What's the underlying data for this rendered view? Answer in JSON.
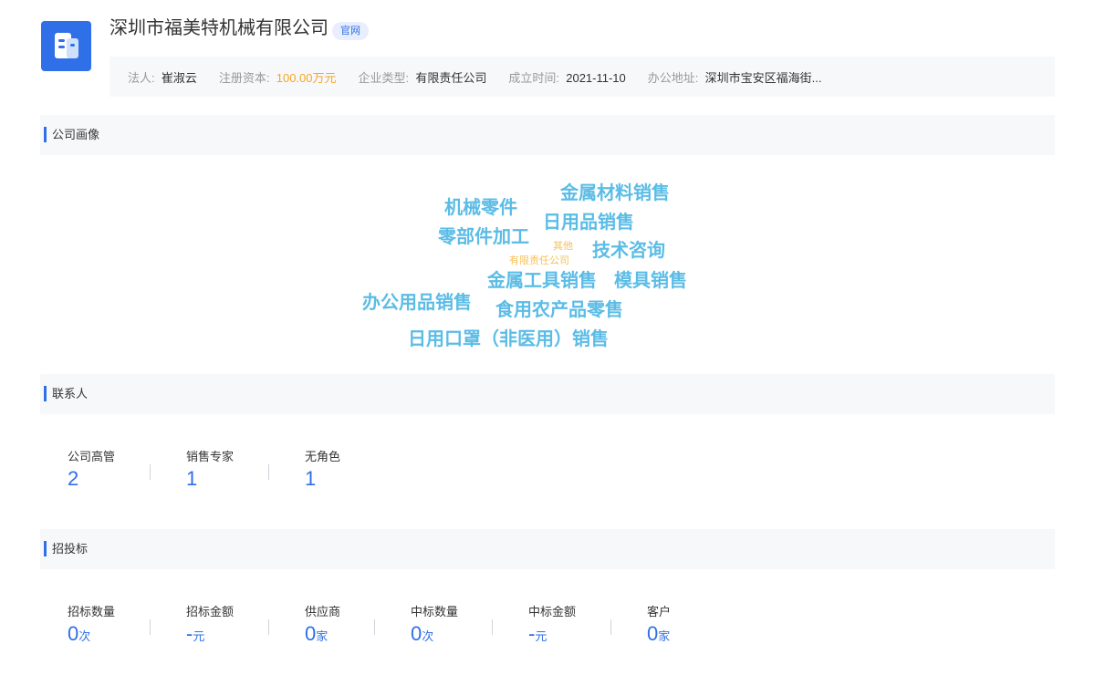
{
  "company": {
    "name": "深圳市福美特机械有限公司",
    "official_tag": "官网",
    "info": [
      {
        "label": "法人:",
        "value": "崔淑云",
        "color": "#333333"
      },
      {
        "label": "注册资本:",
        "value": "100.00万元",
        "color": "#f5a623"
      },
      {
        "label": "企业类型:",
        "value": "有限责任公司",
        "color": "#333333"
      },
      {
        "label": "成立时间:",
        "value": "2021-11-10",
        "color": "#333333"
      },
      {
        "label": "办公地址:",
        "value": "深圳市宝安区福海街...",
        "color": "#333333"
      }
    ]
  },
  "sections": {
    "portrait": "公司画像",
    "contacts": "联系人",
    "bidding": "招投标"
  },
  "word_cloud": [
    "金属材料销售",
    "机械零件",
    "日用品销售",
    "零部件加工",
    "其他",
    "技术咨询",
    "有限责任公司",
    "金属工具销售",
    "模具销售",
    "办公用品销售",
    "食用农产品零售",
    "日用口罩（非医用）销售"
  ],
  "contacts": [
    {
      "label": "公司高管",
      "value": "2"
    },
    {
      "label": "销售专家",
      "value": "1"
    },
    {
      "label": "无角色",
      "value": "1"
    }
  ],
  "bidding": [
    {
      "label": "招标数量",
      "value": "0",
      "unit": "次"
    },
    {
      "label": "招标金额",
      "value": "-",
      "unit": "元"
    },
    {
      "label": "供应商",
      "value": "0",
      "unit": "家"
    },
    {
      "label": "中标数量",
      "value": "0",
      "unit": "次"
    },
    {
      "label": "中标金额",
      "value": "-",
      "unit": "元"
    },
    {
      "label": "客户",
      "value": "0",
      "unit": "家"
    }
  ],
  "colors": {
    "accent": "#2f6fe8",
    "cloud_blue": "#5bbce6",
    "cloud_orange": "#f6c15b",
    "capital_orange": "#f5a623"
  }
}
